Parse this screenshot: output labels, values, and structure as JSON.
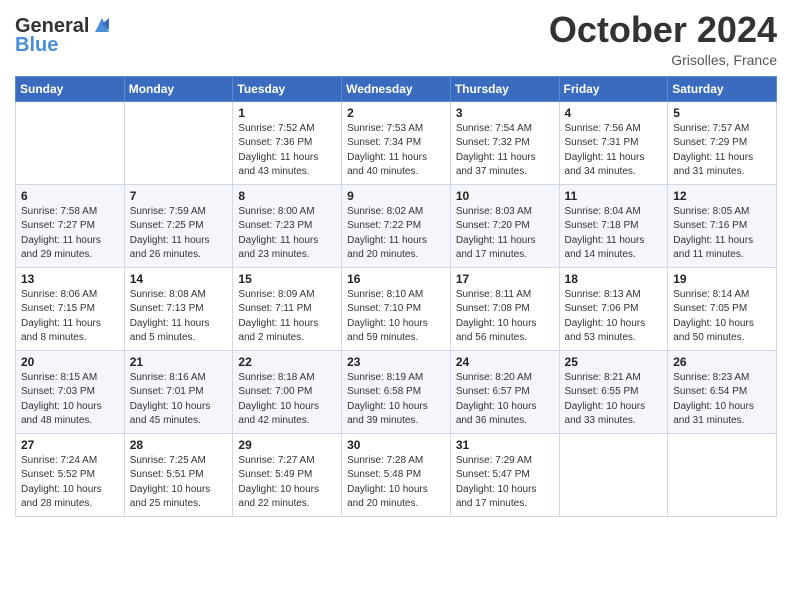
{
  "header": {
    "logo_line1": "General",
    "logo_line2": "Blue",
    "month_title": "October 2024",
    "location": "Grisolles, France"
  },
  "days_of_week": [
    "Sunday",
    "Monday",
    "Tuesday",
    "Wednesday",
    "Thursday",
    "Friday",
    "Saturday"
  ],
  "weeks": [
    [
      {
        "day": "",
        "sunrise": "",
        "sunset": "",
        "daylight": ""
      },
      {
        "day": "",
        "sunrise": "",
        "sunset": "",
        "daylight": ""
      },
      {
        "day": "1",
        "sunrise": "Sunrise: 7:52 AM",
        "sunset": "Sunset: 7:36 PM",
        "daylight": "Daylight: 11 hours and 43 minutes."
      },
      {
        "day": "2",
        "sunrise": "Sunrise: 7:53 AM",
        "sunset": "Sunset: 7:34 PM",
        "daylight": "Daylight: 11 hours and 40 minutes."
      },
      {
        "day": "3",
        "sunrise": "Sunrise: 7:54 AM",
        "sunset": "Sunset: 7:32 PM",
        "daylight": "Daylight: 11 hours and 37 minutes."
      },
      {
        "day": "4",
        "sunrise": "Sunrise: 7:56 AM",
        "sunset": "Sunset: 7:31 PM",
        "daylight": "Daylight: 11 hours and 34 minutes."
      },
      {
        "day": "5",
        "sunrise": "Sunrise: 7:57 AM",
        "sunset": "Sunset: 7:29 PM",
        "daylight": "Daylight: 11 hours and 31 minutes."
      }
    ],
    [
      {
        "day": "6",
        "sunrise": "Sunrise: 7:58 AM",
        "sunset": "Sunset: 7:27 PM",
        "daylight": "Daylight: 11 hours and 29 minutes."
      },
      {
        "day": "7",
        "sunrise": "Sunrise: 7:59 AM",
        "sunset": "Sunset: 7:25 PM",
        "daylight": "Daylight: 11 hours and 26 minutes."
      },
      {
        "day": "8",
        "sunrise": "Sunrise: 8:00 AM",
        "sunset": "Sunset: 7:23 PM",
        "daylight": "Daylight: 11 hours and 23 minutes."
      },
      {
        "day": "9",
        "sunrise": "Sunrise: 8:02 AM",
        "sunset": "Sunset: 7:22 PM",
        "daylight": "Daylight: 11 hours and 20 minutes."
      },
      {
        "day": "10",
        "sunrise": "Sunrise: 8:03 AM",
        "sunset": "Sunset: 7:20 PM",
        "daylight": "Daylight: 11 hours and 17 minutes."
      },
      {
        "day": "11",
        "sunrise": "Sunrise: 8:04 AM",
        "sunset": "Sunset: 7:18 PM",
        "daylight": "Daylight: 11 hours and 14 minutes."
      },
      {
        "day": "12",
        "sunrise": "Sunrise: 8:05 AM",
        "sunset": "Sunset: 7:16 PM",
        "daylight": "Daylight: 11 hours and 11 minutes."
      }
    ],
    [
      {
        "day": "13",
        "sunrise": "Sunrise: 8:06 AM",
        "sunset": "Sunset: 7:15 PM",
        "daylight": "Daylight: 11 hours and 8 minutes."
      },
      {
        "day": "14",
        "sunrise": "Sunrise: 8:08 AM",
        "sunset": "Sunset: 7:13 PM",
        "daylight": "Daylight: 11 hours and 5 minutes."
      },
      {
        "day": "15",
        "sunrise": "Sunrise: 8:09 AM",
        "sunset": "Sunset: 7:11 PM",
        "daylight": "Daylight: 11 hours and 2 minutes."
      },
      {
        "day": "16",
        "sunrise": "Sunrise: 8:10 AM",
        "sunset": "Sunset: 7:10 PM",
        "daylight": "Daylight: 10 hours and 59 minutes."
      },
      {
        "day": "17",
        "sunrise": "Sunrise: 8:11 AM",
        "sunset": "Sunset: 7:08 PM",
        "daylight": "Daylight: 10 hours and 56 minutes."
      },
      {
        "day": "18",
        "sunrise": "Sunrise: 8:13 AM",
        "sunset": "Sunset: 7:06 PM",
        "daylight": "Daylight: 10 hours and 53 minutes."
      },
      {
        "day": "19",
        "sunrise": "Sunrise: 8:14 AM",
        "sunset": "Sunset: 7:05 PM",
        "daylight": "Daylight: 10 hours and 50 minutes."
      }
    ],
    [
      {
        "day": "20",
        "sunrise": "Sunrise: 8:15 AM",
        "sunset": "Sunset: 7:03 PM",
        "daylight": "Daylight: 10 hours and 48 minutes."
      },
      {
        "day": "21",
        "sunrise": "Sunrise: 8:16 AM",
        "sunset": "Sunset: 7:01 PM",
        "daylight": "Daylight: 10 hours and 45 minutes."
      },
      {
        "day": "22",
        "sunrise": "Sunrise: 8:18 AM",
        "sunset": "Sunset: 7:00 PM",
        "daylight": "Daylight: 10 hours and 42 minutes."
      },
      {
        "day": "23",
        "sunrise": "Sunrise: 8:19 AM",
        "sunset": "Sunset: 6:58 PM",
        "daylight": "Daylight: 10 hours and 39 minutes."
      },
      {
        "day": "24",
        "sunrise": "Sunrise: 8:20 AM",
        "sunset": "Sunset: 6:57 PM",
        "daylight": "Daylight: 10 hours and 36 minutes."
      },
      {
        "day": "25",
        "sunrise": "Sunrise: 8:21 AM",
        "sunset": "Sunset: 6:55 PM",
        "daylight": "Daylight: 10 hours and 33 minutes."
      },
      {
        "day": "26",
        "sunrise": "Sunrise: 8:23 AM",
        "sunset": "Sunset: 6:54 PM",
        "daylight": "Daylight: 10 hours and 31 minutes."
      }
    ],
    [
      {
        "day": "27",
        "sunrise": "Sunrise: 7:24 AM",
        "sunset": "Sunset: 5:52 PM",
        "daylight": "Daylight: 10 hours and 28 minutes."
      },
      {
        "day": "28",
        "sunrise": "Sunrise: 7:25 AM",
        "sunset": "Sunset: 5:51 PM",
        "daylight": "Daylight: 10 hours and 25 minutes."
      },
      {
        "day": "29",
        "sunrise": "Sunrise: 7:27 AM",
        "sunset": "Sunset: 5:49 PM",
        "daylight": "Daylight: 10 hours and 22 minutes."
      },
      {
        "day": "30",
        "sunrise": "Sunrise: 7:28 AM",
        "sunset": "Sunset: 5:48 PM",
        "daylight": "Daylight: 10 hours and 20 minutes."
      },
      {
        "day": "31",
        "sunrise": "Sunrise: 7:29 AM",
        "sunset": "Sunset: 5:47 PM",
        "daylight": "Daylight: 10 hours and 17 minutes."
      },
      {
        "day": "",
        "sunrise": "",
        "sunset": "",
        "daylight": ""
      },
      {
        "day": "",
        "sunrise": "",
        "sunset": "",
        "daylight": ""
      }
    ]
  ]
}
